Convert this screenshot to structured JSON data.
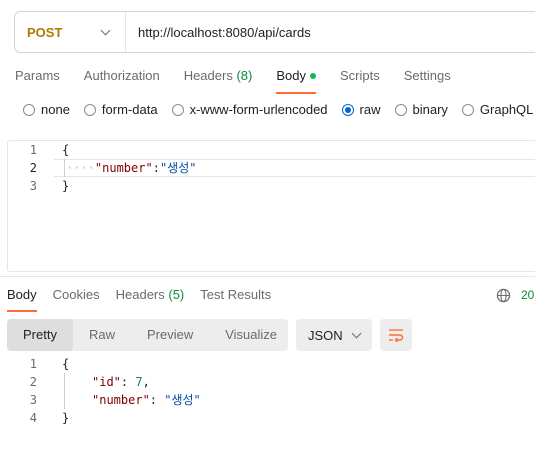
{
  "request": {
    "method": "POST",
    "url": "http://localhost:8080/api/cards"
  },
  "request_tabs": [
    {
      "label": "Params"
    },
    {
      "label": "Authorization"
    },
    {
      "label": "Headers",
      "count": "(8)"
    },
    {
      "label": "Body",
      "active": true
    },
    {
      "label": "Scripts"
    },
    {
      "label": "Settings"
    }
  ],
  "body_types": [
    {
      "label": "none"
    },
    {
      "label": "form-data"
    },
    {
      "label": "x-www-form-urlencoded"
    },
    {
      "label": "raw",
      "checked": true
    },
    {
      "label": "binary"
    },
    {
      "label": "GraphQL"
    }
  ],
  "request_body": {
    "line_numbers": [
      "1",
      "2",
      "3"
    ],
    "open_brace": "{",
    "indent": "····",
    "key": "\"number\"",
    "colon": ":",
    "value": "\"생성\"",
    "close_brace": "}"
  },
  "response_tabs": [
    {
      "label": "Body",
      "active": true
    },
    {
      "label": "Cookies"
    },
    {
      "label": "Headers",
      "count": "(5)"
    },
    {
      "label": "Test Results"
    }
  ],
  "status_code": "20",
  "view_modes": [
    "Pretty",
    "Raw",
    "Preview",
    "Visualize"
  ],
  "active_view_mode": "Pretty",
  "format": "JSON",
  "response_body": {
    "line_numbers": [
      "1",
      "2",
      "3",
      "4"
    ],
    "open_brace": "{",
    "id_key": "\"id\"",
    "id_value": "7",
    "number_key": "\"number\"",
    "number_value": "\"생성\"",
    "close_brace": "}"
  },
  "colors": {
    "method": "#ad7a03",
    "accent": "#ff6c37",
    "radio_checked": "#0265d2",
    "count_green": "#0f8a3c",
    "dot_green": "#0cbb52"
  },
  "icons": {
    "method_dropdown": "chevron-down-icon",
    "format_dropdown": "chevron-down-icon",
    "network": "globe-icon",
    "wrap": "wrap-lines-icon"
  }
}
